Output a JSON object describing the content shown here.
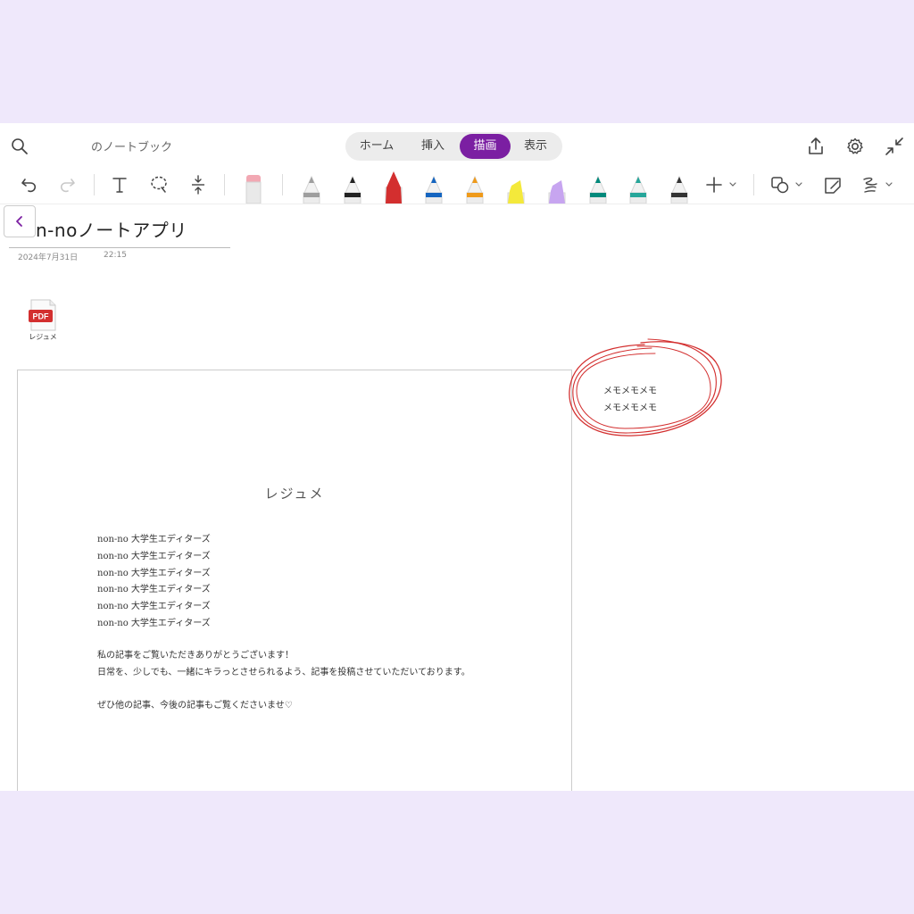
{
  "header": {
    "notebook_title": "のノートブック",
    "tabs": [
      {
        "label": "ホーム",
        "active": false
      },
      {
        "label": "挿入",
        "active": false
      },
      {
        "label": "描画",
        "active": true
      },
      {
        "label": "表示",
        "active": false
      }
    ],
    "accent_color": "#7b1fa2"
  },
  "icons": [
    "search-icon",
    "share-icon",
    "settings-icon",
    "collapse-icon"
  ],
  "toolbar": {
    "tools": [
      "undo-icon",
      "redo-icon",
      "text-icon",
      "lasso-icon",
      "insert-space-icon",
      "eraser-icon"
    ],
    "pens": [
      {
        "name": "pencil",
        "color": "#9e9e9e"
      },
      {
        "name": "black-pen",
        "color": "#222222"
      },
      {
        "name": "red-pen",
        "color": "#d32f2f"
      },
      {
        "name": "blue-pen",
        "color": "#1565c0"
      },
      {
        "name": "orange-pen",
        "color": "#ef9a1a"
      },
      {
        "name": "yellow-highlighter",
        "color": "#f4e93b"
      },
      {
        "name": "lavender-highlighter",
        "color": "#c7a5f0"
      },
      {
        "name": "teal-pen",
        "color": "#00897b"
      },
      {
        "name": "aqua-pen",
        "color": "#26a69a"
      },
      {
        "name": "dark-pen",
        "color": "#333333"
      }
    ],
    "extra": [
      "add-pen-icon",
      "shapes-icon",
      "sticky-note-icon",
      "ink-convert-icon"
    ]
  },
  "page": {
    "title": "n-noノートアプリ",
    "date": "2024年7月31日",
    "time": "22:15",
    "attachment_name": "レジュメ",
    "attachment_badge": "PDF"
  },
  "document": {
    "heading": "レジュメ",
    "lines": [
      "non-no 大学生エディターズ",
      "non-no 大学生エディターズ",
      "non-no 大学生エディターズ",
      "non-no 大学生エディターズ",
      "non-no 大学生エディターズ",
      "non-no 大学生エディターズ"
    ],
    "body": [
      "私の記事をご覧いただきありがとうございます！",
      "日常を、少しでも、一緒にキラっとさせられるよう、記事を投稿させていただいております。",
      "",
      "ぜひ他の記事、今後の記事もご覧くださいませ♡"
    ]
  },
  "memo": {
    "lines": [
      "メモメモメモ",
      "メモメモメモ"
    ],
    "ink_color": "#d32f2f"
  }
}
